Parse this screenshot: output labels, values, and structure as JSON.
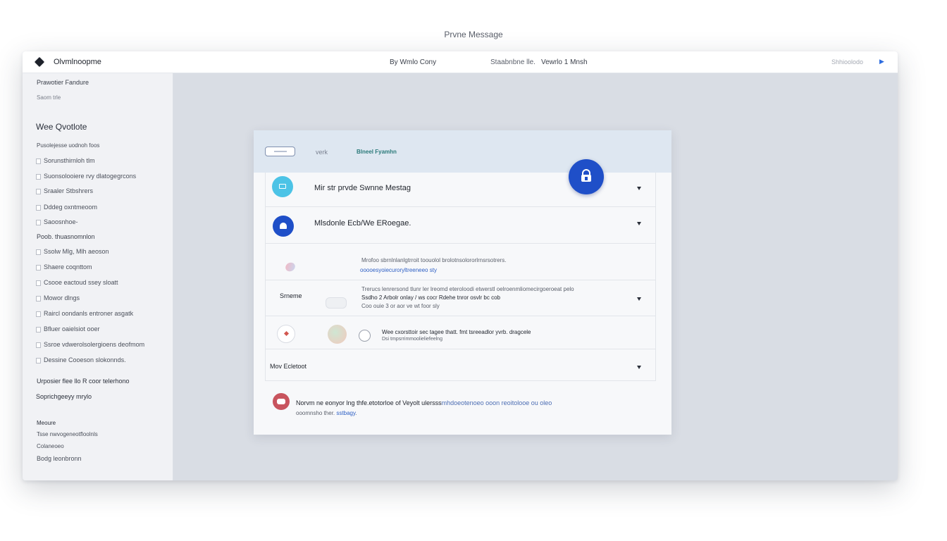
{
  "page": {
    "caption": "Prvne Message"
  },
  "titlebar": {
    "app_name": "Olvmlnoopme",
    "by_line": "By Wmlo Cony",
    "session_label": "Staabnbne lle.",
    "session_value": "Vewrlo 1 Mnsh",
    "status_text": "Shhioolodo"
  },
  "sidebar": {
    "top_label": "Prawotier Fandure",
    "sub_label": "Saom trle",
    "heading": "Wee Qvotlote",
    "intro": "Pusolejesse uodnoh foos",
    "items_a": [
      "Sorunsthirnloh tlm",
      "Suonsolooiere rvy dlatogegrcons",
      "Sraaler Stbshrers",
      "Dddeg oxntmeoom",
      "Saoosnhoe-"
    ],
    "subheading": "Poob. thuasnomnlon",
    "items_b": [
      "Ssolw Mlg, Mlh aeoson",
      "Shaere coqnttom",
      "Csooe eactoud ssey sloatt",
      "Mowor dlngs",
      "Raircl oondanls entroner asgatk",
      "Bfluer oaielsiot ooer",
      "Ssroe vdwerolsolergioens deofmom",
      "Dessine Cooeson slokonnds."
    ],
    "notes": [
      "Urposier flee llo R coor telerhono",
      "Soprichgeeyy mrylo"
    ],
    "footer_title": "Meoure",
    "footer_items": [
      "Tsse nwvogeneotfloolnls",
      "Colaneoeo",
      "Bodg leonbronn"
    ]
  },
  "card": {
    "header": {
      "link_label": "verk",
      "active_label": "Blneel Fyamhn"
    },
    "rows": [
      {
        "title": "Mir str prvde Swnne Mestag",
        "icon": "message-icon",
        "color": "#4cc3e6"
      },
      {
        "title": "Mlsdonle Ecb/We ERoegae.",
        "icon": "chat-icon",
        "color": "#1f4fc8"
      }
    ],
    "detail_row": {
      "line1": "Mrofoo sbrnlnlanlgtrroit toouolol brolotnsolororlrnsrsotrers.",
      "line2": "ooooesyoiecuroryltreeneeo sty"
    },
    "sender_row": {
      "label": "Srneme",
      "line1": "Trerucs lenrersond tlunr ler lreomd eteroloodi etwerstl oelroenmliomecirgoeroeat pelo",
      "line2": "Ssdho 2 Arbolr onlay / ws cocr Rdehe tnror osvlr bc cob",
      "line3": "Coo ouie 3 or aor ve wt foor sly"
    },
    "attachment_row": {
      "line1": "Wee cxorsttoir sec tagee thatt. fmt tsreeadlor yvrb. dragcele",
      "line2": "Dsi tmpsrrimmoolieliefeelng"
    },
    "expander": {
      "title": "Mov Ecletoot"
    },
    "footer": {
      "text": "Norvm ne eonyor lng thfe.etotorloe of Veyolt ulersss",
      "text_link": "mhdoeotenoeo ooon reoitolooe ou oleo",
      "line2": "ooomnsho ther.",
      "line2_link": "sstbagy"
    }
  }
}
